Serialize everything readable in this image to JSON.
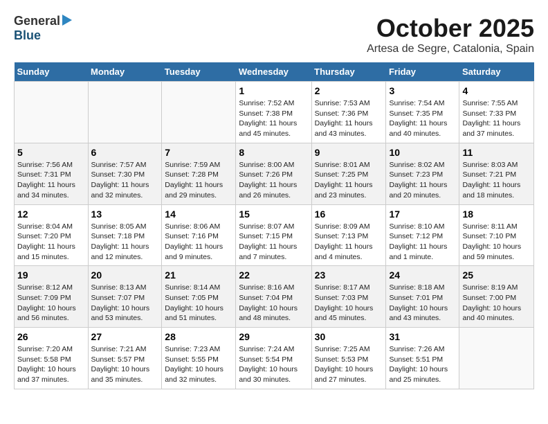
{
  "header": {
    "logo_general": "General",
    "logo_blue": "Blue",
    "month": "October 2025",
    "location": "Artesa de Segre, Catalonia, Spain"
  },
  "weekdays": [
    "Sunday",
    "Monday",
    "Tuesday",
    "Wednesday",
    "Thursday",
    "Friday",
    "Saturday"
  ],
  "weeks": [
    [
      {
        "day": "",
        "info": ""
      },
      {
        "day": "",
        "info": ""
      },
      {
        "day": "",
        "info": ""
      },
      {
        "day": "1",
        "info": "Sunrise: 7:52 AM\nSunset: 7:38 PM\nDaylight: 11 hours and 45 minutes."
      },
      {
        "day": "2",
        "info": "Sunrise: 7:53 AM\nSunset: 7:36 PM\nDaylight: 11 hours and 43 minutes."
      },
      {
        "day": "3",
        "info": "Sunrise: 7:54 AM\nSunset: 7:35 PM\nDaylight: 11 hours and 40 minutes."
      },
      {
        "day": "4",
        "info": "Sunrise: 7:55 AM\nSunset: 7:33 PM\nDaylight: 11 hours and 37 minutes."
      }
    ],
    [
      {
        "day": "5",
        "info": "Sunrise: 7:56 AM\nSunset: 7:31 PM\nDaylight: 11 hours and 34 minutes."
      },
      {
        "day": "6",
        "info": "Sunrise: 7:57 AM\nSunset: 7:30 PM\nDaylight: 11 hours and 32 minutes."
      },
      {
        "day": "7",
        "info": "Sunrise: 7:59 AM\nSunset: 7:28 PM\nDaylight: 11 hours and 29 minutes."
      },
      {
        "day": "8",
        "info": "Sunrise: 8:00 AM\nSunset: 7:26 PM\nDaylight: 11 hours and 26 minutes."
      },
      {
        "day": "9",
        "info": "Sunrise: 8:01 AM\nSunset: 7:25 PM\nDaylight: 11 hours and 23 minutes."
      },
      {
        "day": "10",
        "info": "Sunrise: 8:02 AM\nSunset: 7:23 PM\nDaylight: 11 hours and 20 minutes."
      },
      {
        "day": "11",
        "info": "Sunrise: 8:03 AM\nSunset: 7:21 PM\nDaylight: 11 hours and 18 minutes."
      }
    ],
    [
      {
        "day": "12",
        "info": "Sunrise: 8:04 AM\nSunset: 7:20 PM\nDaylight: 11 hours and 15 minutes."
      },
      {
        "day": "13",
        "info": "Sunrise: 8:05 AM\nSunset: 7:18 PM\nDaylight: 11 hours and 12 minutes."
      },
      {
        "day": "14",
        "info": "Sunrise: 8:06 AM\nSunset: 7:16 PM\nDaylight: 11 hours and 9 minutes."
      },
      {
        "day": "15",
        "info": "Sunrise: 8:07 AM\nSunset: 7:15 PM\nDaylight: 11 hours and 7 minutes."
      },
      {
        "day": "16",
        "info": "Sunrise: 8:09 AM\nSunset: 7:13 PM\nDaylight: 11 hours and 4 minutes."
      },
      {
        "day": "17",
        "info": "Sunrise: 8:10 AM\nSunset: 7:12 PM\nDaylight: 11 hours and 1 minute."
      },
      {
        "day": "18",
        "info": "Sunrise: 8:11 AM\nSunset: 7:10 PM\nDaylight: 10 hours and 59 minutes."
      }
    ],
    [
      {
        "day": "19",
        "info": "Sunrise: 8:12 AM\nSunset: 7:09 PM\nDaylight: 10 hours and 56 minutes."
      },
      {
        "day": "20",
        "info": "Sunrise: 8:13 AM\nSunset: 7:07 PM\nDaylight: 10 hours and 53 minutes."
      },
      {
        "day": "21",
        "info": "Sunrise: 8:14 AM\nSunset: 7:05 PM\nDaylight: 10 hours and 51 minutes."
      },
      {
        "day": "22",
        "info": "Sunrise: 8:16 AM\nSunset: 7:04 PM\nDaylight: 10 hours and 48 minutes."
      },
      {
        "day": "23",
        "info": "Sunrise: 8:17 AM\nSunset: 7:03 PM\nDaylight: 10 hours and 45 minutes."
      },
      {
        "day": "24",
        "info": "Sunrise: 8:18 AM\nSunset: 7:01 PM\nDaylight: 10 hours and 43 minutes."
      },
      {
        "day": "25",
        "info": "Sunrise: 8:19 AM\nSunset: 7:00 PM\nDaylight: 10 hours and 40 minutes."
      }
    ],
    [
      {
        "day": "26",
        "info": "Sunrise: 7:20 AM\nSunset: 5:58 PM\nDaylight: 10 hours and 37 minutes."
      },
      {
        "day": "27",
        "info": "Sunrise: 7:21 AM\nSunset: 5:57 PM\nDaylight: 10 hours and 35 minutes."
      },
      {
        "day": "28",
        "info": "Sunrise: 7:23 AM\nSunset: 5:55 PM\nDaylight: 10 hours and 32 minutes."
      },
      {
        "day": "29",
        "info": "Sunrise: 7:24 AM\nSunset: 5:54 PM\nDaylight: 10 hours and 30 minutes."
      },
      {
        "day": "30",
        "info": "Sunrise: 7:25 AM\nSunset: 5:53 PM\nDaylight: 10 hours and 27 minutes."
      },
      {
        "day": "31",
        "info": "Sunrise: 7:26 AM\nSunset: 5:51 PM\nDaylight: 10 hours and 25 minutes."
      },
      {
        "day": "",
        "info": ""
      }
    ]
  ]
}
